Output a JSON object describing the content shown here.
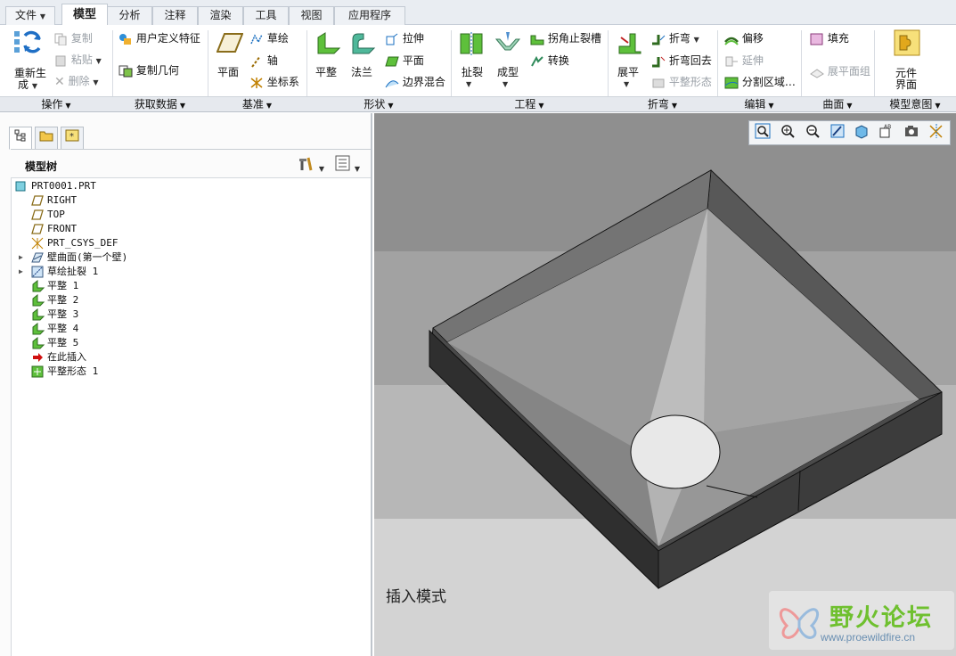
{
  "tabs": [
    {
      "label": "文件",
      "active": false
    },
    {
      "label": "模型",
      "active": true
    },
    {
      "label": "分析",
      "active": false
    },
    {
      "label": "注释",
      "active": false
    },
    {
      "label": "渲染",
      "active": false
    },
    {
      "label": "工具",
      "active": false
    },
    {
      "label": "视图",
      "active": false
    },
    {
      "label": "应用程序",
      "active": false
    }
  ],
  "ribbon": {
    "operations": {
      "regenerate": "重新生",
      "regenerate2": "成",
      "copy": "复制",
      "paste": "粘贴",
      "delete": "删除"
    },
    "get_data": {
      "udf": "用户定义特征",
      "copy_geom": "复制几何"
    },
    "datum": {
      "plane": "平面",
      "sketch": "草绘",
      "axis": "轴",
      "csys": "坐标系"
    },
    "shapes": {
      "flat": "平整",
      "flange": "法兰",
      "extrude": "拉伸",
      "plane": "平面",
      "blend": "边界混合"
    },
    "engineering": {
      "rip": "扯裂",
      "form": "成型",
      "corner_relief": "拐角止裂槽",
      "convert": "转换"
    },
    "bends": {
      "unbend": "展平",
      "bend": "折弯",
      "bend_back": "折弯回去",
      "flat_state": "平整形态"
    },
    "editing": {
      "offset": "偏移",
      "extend": "延伸",
      "split": "分割区域…"
    },
    "surfaces": {
      "fill": "填充",
      "flat_pattern_group": "展平面组"
    },
    "intent": {
      "component": "元件",
      "component2": "界面"
    }
  },
  "groups": [
    "操作",
    "获取数据",
    "基准",
    "形状",
    "工程",
    "折弯",
    "编辑",
    "曲面",
    "模型意图"
  ],
  "model_tree": {
    "title": "模型树",
    "items": [
      {
        "label": "PRT0001.PRT",
        "icon": "part-icon"
      },
      {
        "label": "RIGHT",
        "icon": "datum-plane-icon"
      },
      {
        "label": "TOP",
        "icon": "datum-plane-icon"
      },
      {
        "label": "FRONT",
        "icon": "datum-plane-icon"
      },
      {
        "label": "PRT_CSYS_DEF",
        "icon": "csys-icon"
      },
      {
        "label": "壁曲面(第一个壁)",
        "icon": "wall-icon"
      },
      {
        "label": "草绘扯裂 1",
        "icon": "sketch-rip-icon"
      },
      {
        "label": "平整 1",
        "icon": "flat-wall-icon"
      },
      {
        "label": "平整 2",
        "icon": "flat-wall-icon"
      },
      {
        "label": "平整 3",
        "icon": "flat-wall-icon"
      },
      {
        "label": "平整 4",
        "icon": "flat-wall-icon"
      },
      {
        "label": "平整 5",
        "icon": "flat-wall-icon"
      },
      {
        "label": "在此插入",
        "icon": "insert-here-arrow-icon"
      },
      {
        "label": "平整形态 1",
        "icon": "flat-state-icon"
      }
    ]
  },
  "graphics": {
    "mode_text": "插入模式",
    "watermark_cn": "野火论坛",
    "watermark_url": "www.proewildfire.cn"
  },
  "colors": {
    "accent_green": "#6fc02f",
    "tab_bg": "#e9edf2"
  }
}
